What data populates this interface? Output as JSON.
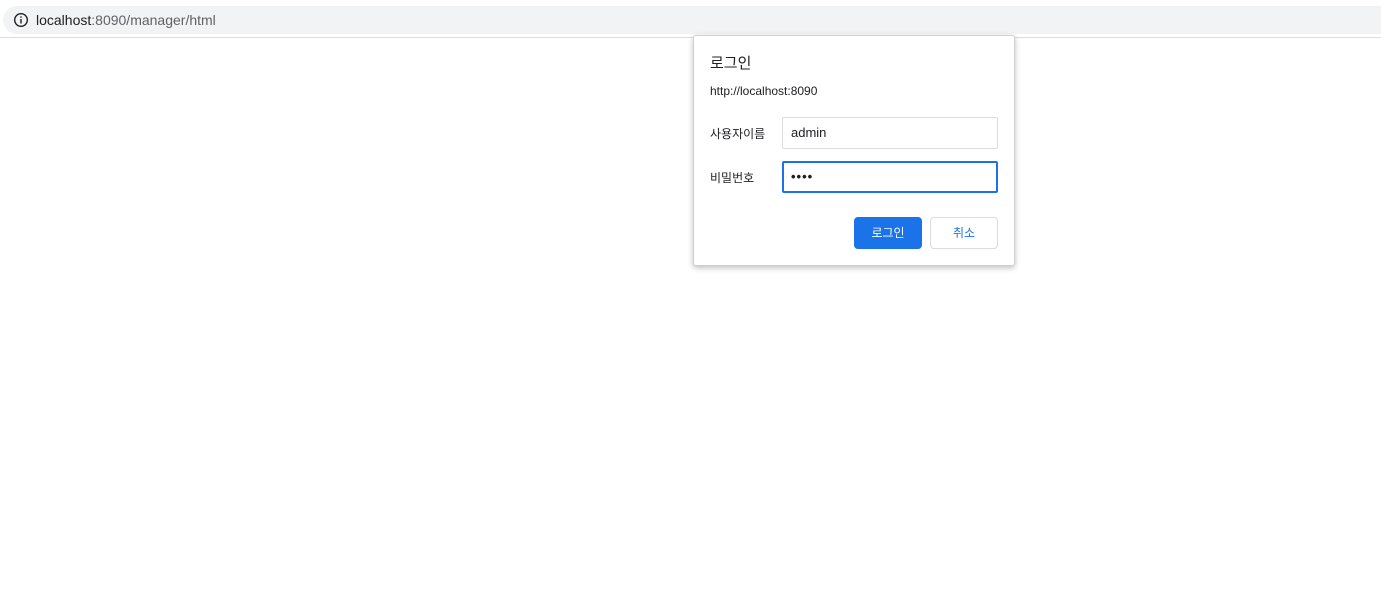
{
  "browser": {
    "url_host": "localhost",
    "url_path": ":8090/manager/html",
    "info_icon": "info-circle-icon"
  },
  "dialog": {
    "title": "로그인",
    "origin": "http://localhost:8090",
    "username_label": "사용자이름",
    "username_value": "admin",
    "password_label": "비밀번호",
    "password_value": "••••",
    "login_button": "로그인",
    "cancel_button": "취소"
  },
  "colors": {
    "accent": "#1a73e8",
    "omnibox_bg": "#f1f3f4",
    "text": "#202124"
  }
}
